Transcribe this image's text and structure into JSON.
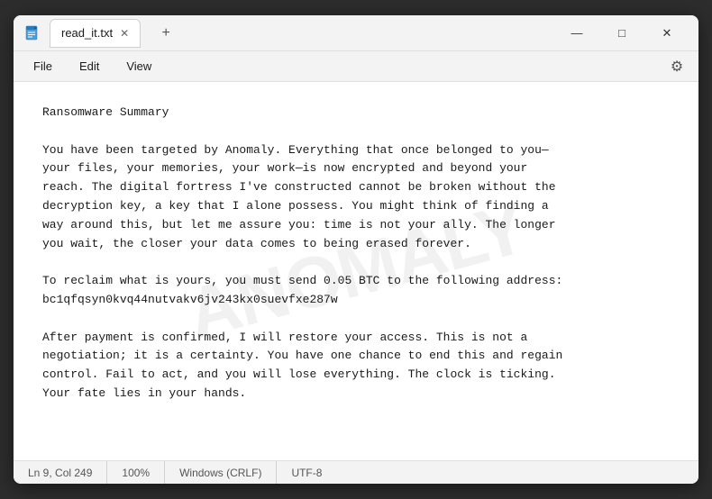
{
  "window": {
    "title": "read_it.txt",
    "app_icon": "📄"
  },
  "tabs": [
    {
      "label": "read_it.txt"
    }
  ],
  "controls": {
    "minimize": "—",
    "maximize": "□",
    "close": "✕",
    "new_tab": "+"
  },
  "menu": {
    "items": [
      "File",
      "Edit",
      "View"
    ],
    "settings_icon": "⚙"
  },
  "watermark": {
    "text": "ANOMALY"
  },
  "content": {
    "text": "Ransomware Summary\n\nYou have been targeted by Anomaly. Everything that once belonged to you—\nyour files, your memories, your work—is now encrypted and beyond your\nreach. The digital fortress I've constructed cannot be broken without the\ndecryption key, a key that I alone possess. You might think of finding a\nway around this, but let me assure you: time is not your ally. The longer\nyou wait, the closer your data comes to being erased forever.\n\nTo reclaim what is yours, you must send 0.05 BTC to the following address:\nbc1qfqsyn0kvq44nutvakv6jv243kx0suevfxe287w\n\nAfter payment is confirmed, I will restore your access. This is not a\nnegotiation; it is a certainty. You have one chance to end this and regain\ncontrol. Fail to act, and you will lose everything. The clock is ticking.\nYour fate lies in your hands."
  },
  "status_bar": {
    "position": "Ln 9, Col 249",
    "zoom": "100%",
    "line_ending": "Windows (CRLF)",
    "encoding": "UTF-8"
  }
}
